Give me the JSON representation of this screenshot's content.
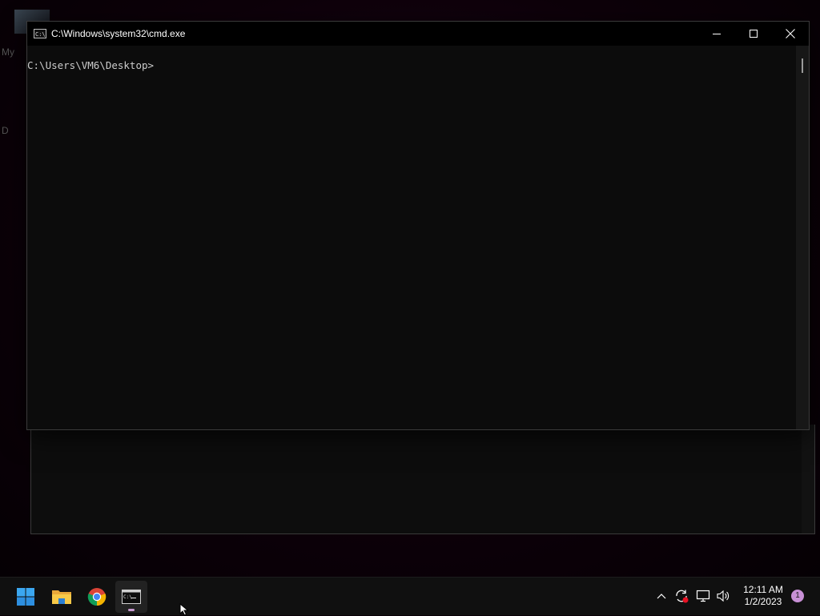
{
  "desktop": {
    "label_1": "My",
    "label_2": "D"
  },
  "window": {
    "title": "C:\\Windows\\system32\\cmd.exe",
    "icon_text": "C:\\",
    "minimize_label": "—",
    "console": {
      "prompt": "C:\\Users\\VM6\\Desktop>"
    }
  },
  "taskbar": {
    "apps": [
      {
        "name": "start",
        "icon": "windows-logo-icon"
      },
      {
        "name": "file-explorer",
        "icon": "folder-icon"
      },
      {
        "name": "chrome",
        "icon": "chrome-icon"
      },
      {
        "name": "command-prompt",
        "icon": "cmd-icon",
        "active": true
      }
    ],
    "clock": {
      "time": "12:11 AM",
      "date": "1/2/2023"
    },
    "notification_count": "1"
  },
  "colors": {
    "console_bg": "#0c0c0c",
    "console_text": "#cccccc",
    "taskbar_bg": "#101010",
    "accent": "#c890d6"
  }
}
